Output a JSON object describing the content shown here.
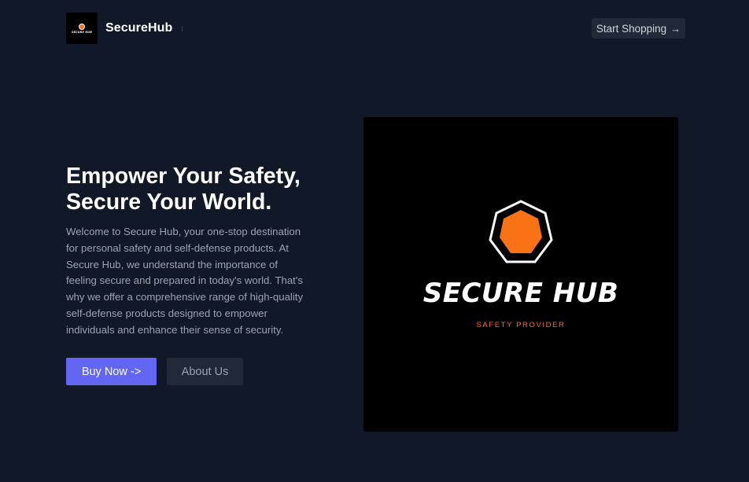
{
  "header": {
    "brand_name": "SecureHub",
    "logo_mini_text": "SECURE HUB",
    "cta_label": "Start Shopping",
    "cta_icon": "arrow-right-icon"
  },
  "hero": {
    "title_line1": "Empower Your Safety,",
    "title_line2": "Secure Your World.",
    "description": "Welcome to Secure Hub, your one-stop destination for personal safety and self-defense products. At Secure Hub, we understand the importance of feeling secure and prepared in today's world. That's why we offer a comprehensive range of high-quality self-defense products designed to empower individuals and enhance their sense of security.",
    "primary_button": "Buy Now ->",
    "secondary_button": "About Us"
  },
  "hero_image": {
    "logo_title": "SECURE HUB",
    "logo_subtitle": "SAFETY PROVIDER",
    "logo_icon": "heptagon-shield-icon"
  },
  "colors": {
    "background": "#111827",
    "accent": "#6366f1",
    "brand_orange": "#f97316",
    "button_dark": "#1f2937",
    "muted_text": "#9ca3af"
  }
}
